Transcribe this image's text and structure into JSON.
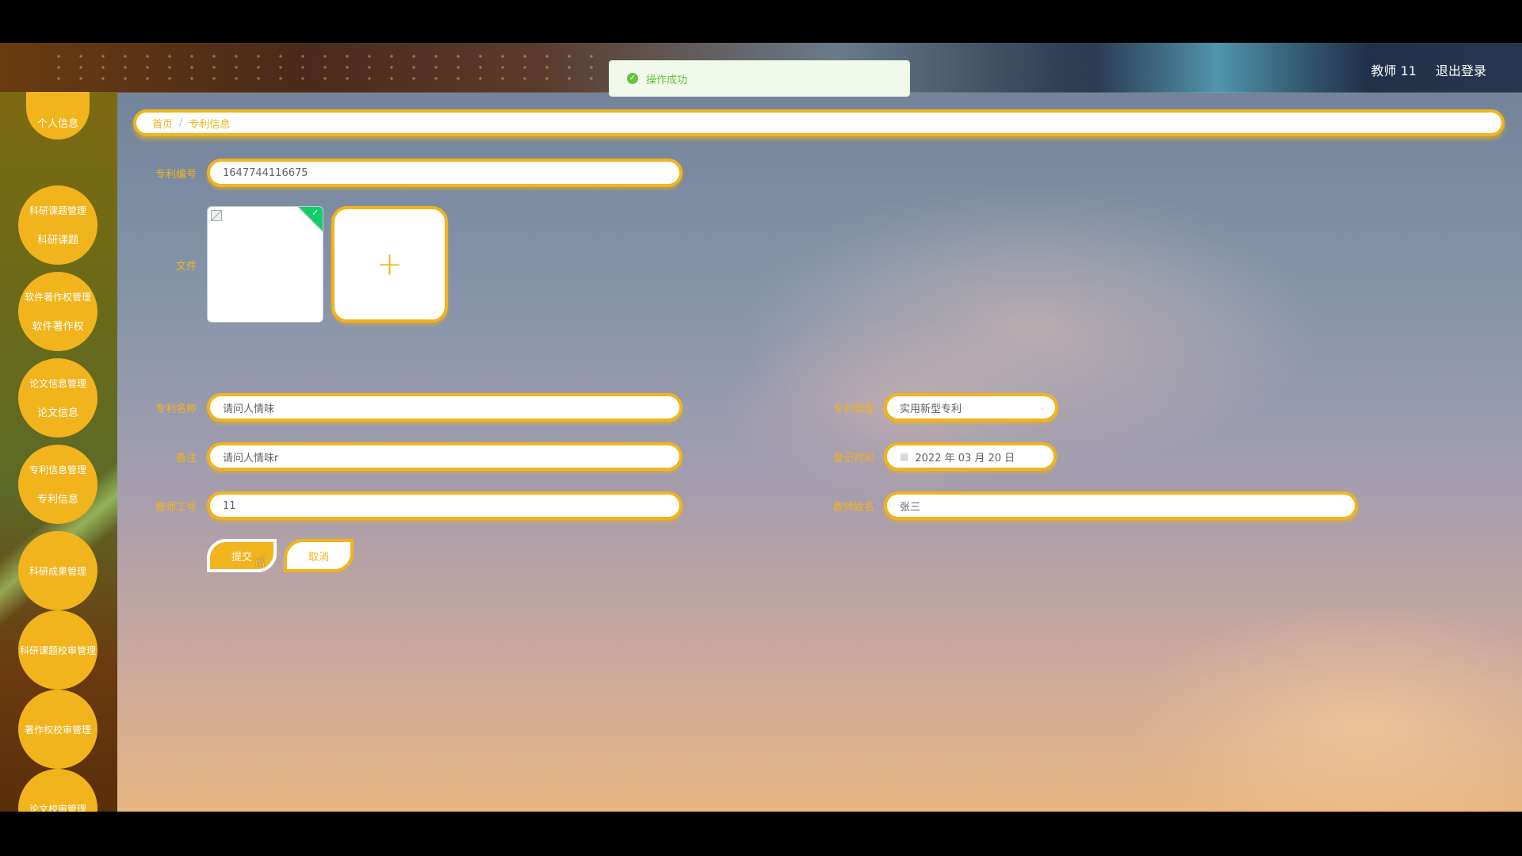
{
  "header": {
    "user_label": "教师 11",
    "logout_label": "退出登录"
  },
  "notification": {
    "message": "操作成功",
    "status_color": "#67c23a"
  },
  "sidebar": {
    "items": [
      {
        "label": "个人信息",
        "sub": ""
      },
      {
        "label": "科研课题管理",
        "sub": "科研课题"
      },
      {
        "label": "软件著作权管理",
        "sub": "软件著作权"
      },
      {
        "label": "论文信息管理",
        "sub": "论文信息"
      },
      {
        "label": "专利信息管理",
        "sub": "专利信息"
      },
      {
        "label": "科研成果管理",
        "sub": ""
      },
      {
        "label": "科研课题校审管理",
        "sub": ""
      },
      {
        "label": "著作权校审管理",
        "sub": ""
      },
      {
        "label": "论文校审管理",
        "sub": ""
      }
    ]
  },
  "breadcrumb": {
    "home": "首页",
    "separator": "/",
    "current": "专利信息"
  },
  "form": {
    "patent_no": {
      "label": "专利编号",
      "value": "1647744116675"
    },
    "file": {
      "label": "文件",
      "add_symbol": "+"
    },
    "patent_name": {
      "label": "专利名称",
      "value": "请问人情味"
    },
    "patent_type": {
      "label": "专利类型",
      "value": "实用新型专利"
    },
    "remark": {
      "label": "备注",
      "value": "请问人情味r"
    },
    "reg_time": {
      "label": "登记时间",
      "value": "2022 年 03 月 20 日"
    },
    "teacher_id": {
      "label": "教师工号",
      "value": "11"
    },
    "teacher_name": {
      "label": "教师姓名",
      "value": "张三"
    },
    "submit_label": "提交",
    "cancel_label": "取消"
  },
  "theme": {
    "accent": "#f2b41c",
    "success": "#13ce66"
  }
}
